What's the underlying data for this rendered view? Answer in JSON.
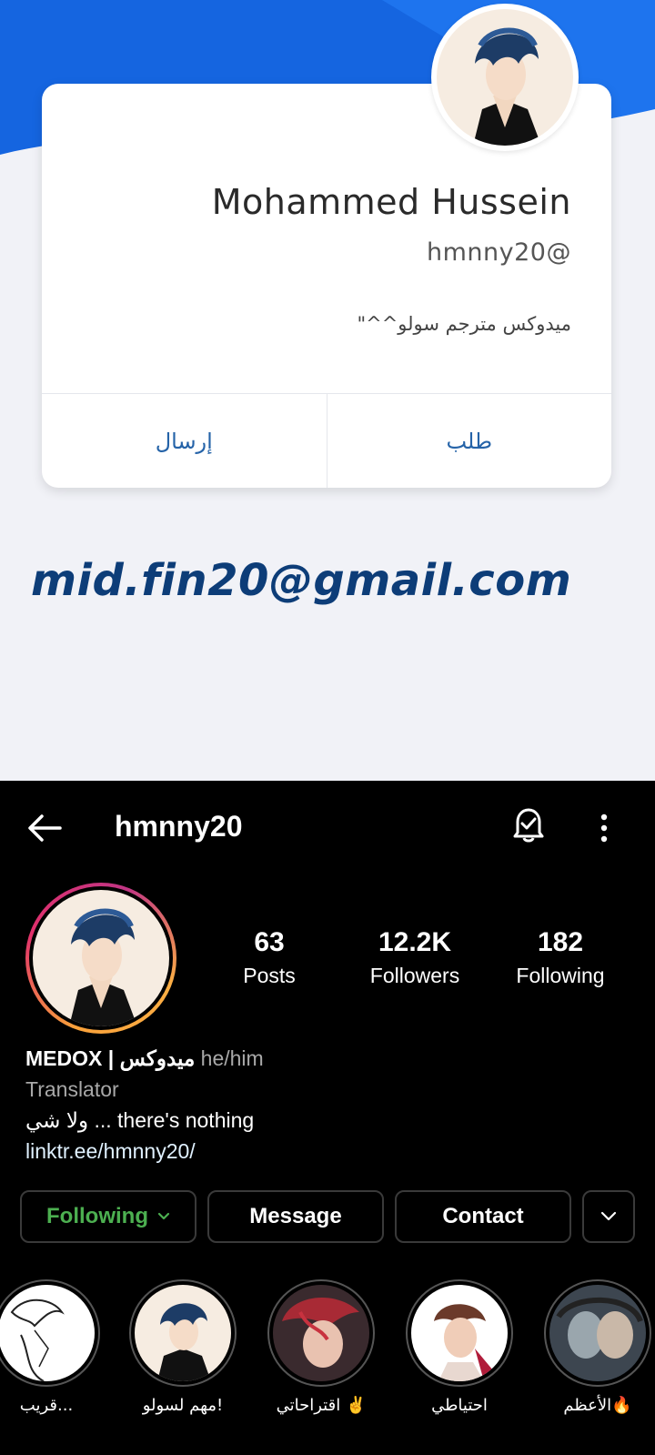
{
  "card": {
    "name": "Mohammed Hussein",
    "handle": "hmnny20@",
    "bio": "ميدوكس مترجم سولو^^\"",
    "action_left": "إرسال",
    "action_right": "طلب"
  },
  "email": "mid.fin20@gmail.com",
  "instagram": {
    "username": "hmnny20",
    "icons": [
      "back-arrow-icon",
      "notification-bell-icon",
      "more-vertical-icon"
    ],
    "stats": {
      "posts_value": "63",
      "posts_label": "Posts",
      "followers_value": "12.2K",
      "followers_label": "Followers",
      "following_value": "182",
      "following_label": "Following"
    },
    "bio": {
      "name": "MEDOX | ميدوكس",
      "pronouns": "he/him",
      "category": "Translator",
      "text": "ولا شي ... there's nothing",
      "link": "linktr.ee/hmnny20/"
    },
    "buttons": {
      "following": "Following",
      "message": "Message",
      "contact": "Contact"
    },
    "highlights": [
      {
        "label": "قريب..."
      },
      {
        "label": "مهم لسولو!"
      },
      {
        "label": "اقتراحاتي ✌️"
      },
      {
        "label": "احتياطي"
      },
      {
        "label": "الأعظم🔥"
      }
    ],
    "colors": {
      "following_green": "#4caf50",
      "background": "#000000"
    }
  }
}
